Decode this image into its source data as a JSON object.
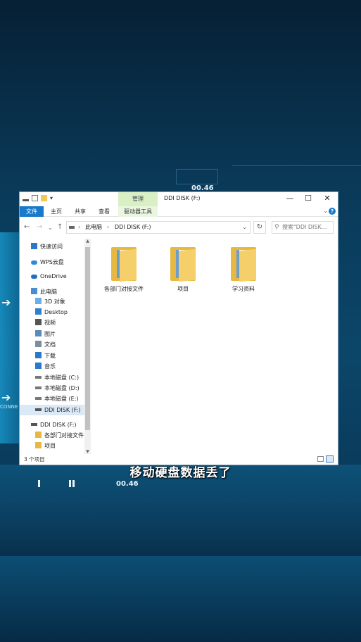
{
  "window": {
    "title": "DDI DISK (F:)",
    "context_tab": "管理",
    "min": "—",
    "max": "☐",
    "close": "✕"
  },
  "ribbon": {
    "tabs": [
      "文件",
      "主页",
      "共享",
      "查看",
      "驱动器工具"
    ],
    "help": "?"
  },
  "address": {
    "crumbs": [
      "此电脑",
      "DDI DISK (F:)"
    ],
    "search_placeholder": "搜索\"DDI DISK..."
  },
  "nav_pane": [
    {
      "label": "快速访问",
      "icon": "star-icon",
      "color": "#2a78c8"
    },
    {
      "label": "WPS云盘",
      "icon": "cloud-icon",
      "color": "#2e8bdb"
    },
    {
      "label": "OneDrive",
      "icon": "onedrive-icon",
      "color": "#1f6fc4"
    },
    {
      "label": "此电脑",
      "icon": "computer-icon",
      "color": "#4a8ed0"
    },
    {
      "label": "3D 对象",
      "icon": "cube-icon",
      "color": "#6aaee8"
    },
    {
      "label": "Desktop",
      "icon": "desktop-icon",
      "color": "#2f7fd0"
    },
    {
      "label": "视频",
      "icon": "video-icon",
      "color": "#555555"
    },
    {
      "label": "图片",
      "icon": "picture-icon",
      "color": "#5a8ab8"
    },
    {
      "label": "文档",
      "icon": "document-icon",
      "color": "#7b8ea0"
    },
    {
      "label": "下载",
      "icon": "download-icon",
      "color": "#2a78c8"
    },
    {
      "label": "音乐",
      "icon": "music-icon",
      "color": "#2a78c8"
    },
    {
      "label": "本地磁盘 (C:)",
      "icon": "drive-icon",
      "color": "#777777"
    },
    {
      "label": "本地磁盘 (D:)",
      "icon": "drive-icon",
      "color": "#777777"
    },
    {
      "label": "本地磁盘 (E:)",
      "icon": "drive-icon",
      "color": "#777777"
    },
    {
      "label": "DDI DISK (F:)",
      "icon": "usb-drive-icon",
      "color": "#555555",
      "selected": true
    },
    {
      "label": "DDI DISK (F:)",
      "icon": "usb-drive-icon",
      "color": "#555555"
    },
    {
      "label": "各部门对接文件",
      "icon": "folder-icon",
      "color": "#e7b842"
    },
    {
      "label": "项目",
      "icon": "folder-icon",
      "color": "#e7b842"
    }
  ],
  "folders": [
    "各部门对接文件",
    "项目",
    "学习资料"
  ],
  "status": {
    "count": "3 个项目"
  },
  "overlay": {
    "timestamp_top": "00.46",
    "timestamp_bottom": "00.46",
    "connect": "CONNE",
    "caption": "移动硬盘数据丢了"
  }
}
